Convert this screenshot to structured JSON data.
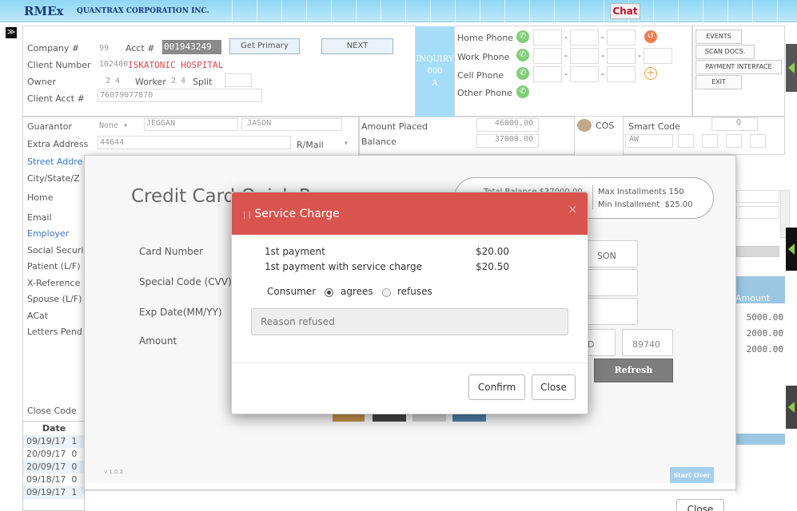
{
  "header": {
    "logo": "RMEx",
    "company": "QUANTRAX CORPORATION INC.",
    "chat": "Chat",
    "toggle": "≫"
  },
  "account": {
    "company_label": "Company #",
    "company": "99",
    "acct_label": "Acct #",
    "acct": "001943249",
    "get_primary": "Get Primary",
    "next": "NEXT",
    "client_label": "Client Number",
    "client_num": "102400",
    "client_name": "ISKATONIC HOSPITAL",
    "owner_label": "Owner",
    "owner": "2 4",
    "worker_label": "Worker",
    "worker": "2 4",
    "split_label": "Split",
    "client_acct_label": "Client Acct #",
    "client_acct": "76079077870"
  },
  "inquiry": {
    "line1": "INQUIRY",
    "line2": "000",
    "line3": "A"
  },
  "phones": {
    "home": "Home Phone",
    "work": "Work Phone",
    "cell": "Cell Phone",
    "other": "Other Phone"
  },
  "side_buttons": {
    "events": "EVENTS",
    "scan": "SCAN DOCS.",
    "payment": "PAYMENT INTERFACE",
    "exit": "EXIT"
  },
  "guarantor": {
    "label": "Guarantor",
    "none": "None ▾",
    "first": "JEGGAN",
    "last": "JASON",
    "extra_label": "Extra Address",
    "extra": "44644",
    "rmail": "R/Mail",
    "rmail_sel": "▾",
    "amount_placed_label": "Amount Placed",
    "amount_placed": "46000.00",
    "balance_label": "Balance",
    "balance": "37000.00",
    "cos": "COS",
    "smart_code_label": "Smart Code",
    "smart_code": "Q",
    "aw": "AW"
  },
  "left_labels": [
    "Street Addre",
    "City/State/Z",
    "Home",
    "Email",
    "Employer",
    "Social Securi",
    "Patient (L/F)",
    "X-Reference",
    "Spouse (L/F)",
    "ACat",
    "Letters Pend"
  ],
  "amounts": {
    "header": "Amount",
    "rows": [
      "5000.00",
      "2000.00",
      "2000.00"
    ]
  },
  "close_code": "Close Code",
  "history": {
    "header": "Date",
    "rows": [
      "09/19/17",
      "20/09/17",
      "20/09/17",
      "09/18/17",
      "09/19/17"
    ],
    "suffix": [
      "1",
      "0",
      "0",
      "0",
      "1"
    ]
  },
  "cc": {
    "title": "Credit Card Quick Pay",
    "info_left": "Total Balance $37000.00",
    "max_inst": "Max Installments 150",
    "min_inst": "Min Installment  $25.00",
    "card_label": "Card Number",
    "cvv_label": "Special Code (CVV)",
    "exp_label": "Exp Date(MM/YY)",
    "amount_label": "Amount",
    "name_val": "SON",
    "zip_val": "D",
    "auth_val": "89740",
    "refresh": "Refresh",
    "version": "v 1.0.2",
    "start_over": "Start Over",
    "close": "Close"
  },
  "modal": {
    "title": "Service Charge",
    "close_x": "×",
    "first_label": "1st payment",
    "first_val": "$20.00",
    "second_label": "1st payment with service charge",
    "second_val": "$20.50",
    "consumer": "Consumer",
    "agrees": "agrees",
    "refuses": "refuses",
    "reason_placeholder": "Reason refused",
    "confirm": "Confirm",
    "close": "Close"
  }
}
